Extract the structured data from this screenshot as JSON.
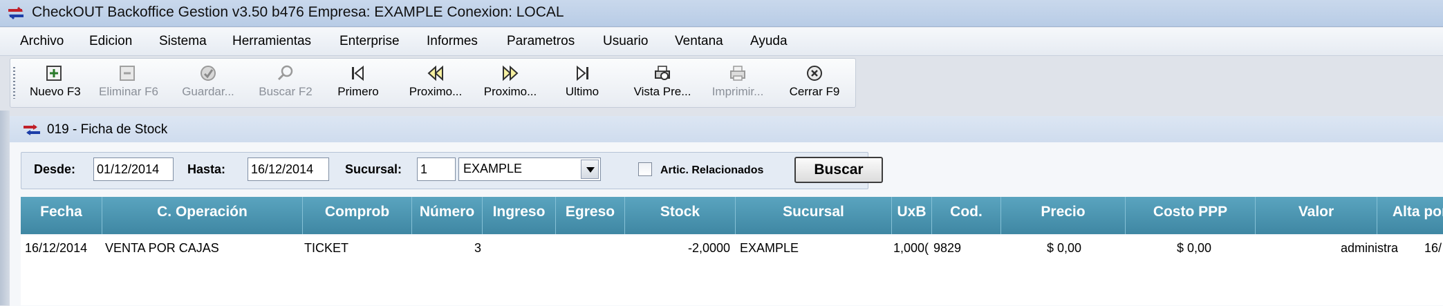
{
  "window": {
    "title": "CheckOUT Backoffice Gestion v3.50 b476 Empresa: EXAMPLE Conexion: LOCAL"
  },
  "menu": [
    {
      "label": "Archivo"
    },
    {
      "label": "Edicion"
    },
    {
      "label": "Sistema"
    },
    {
      "label": "Herramientas"
    },
    {
      "label": "Enterprise"
    },
    {
      "label": "Informes"
    },
    {
      "label": "Parametros"
    },
    {
      "label": "Usuario"
    },
    {
      "label": "Ventana"
    },
    {
      "label": "Ayuda"
    }
  ],
  "toolbar": [
    {
      "label": "Nuevo F3",
      "icon": "new-icon",
      "enabled": true
    },
    {
      "label": "Eliminar F6",
      "icon": "delete-icon",
      "enabled": false
    },
    {
      "label": "Guardar...",
      "icon": "save-icon",
      "enabled": false
    },
    {
      "label": "Buscar F2",
      "icon": "search-icon",
      "enabled": false
    },
    {
      "label": "Primero",
      "icon": "first-icon",
      "enabled": true
    },
    {
      "label": "Proximo...",
      "icon": "previous-icon",
      "enabled": true
    },
    {
      "label": "Proximo...",
      "icon": "next-icon",
      "enabled": true
    },
    {
      "label": "Ultimo",
      "icon": "last-icon",
      "enabled": true
    },
    {
      "label": "Vista Pre...",
      "icon": "print-preview-icon",
      "enabled": true
    },
    {
      "label": "Imprimir...",
      "icon": "print-icon",
      "enabled": false
    },
    {
      "label": "Cerrar F9",
      "icon": "close-icon",
      "enabled": true
    }
  ],
  "form": {
    "title": "019 - Ficha de Stock",
    "filters": {
      "desde_label": "Desde:",
      "desde_value": "01/12/2014",
      "hasta_label": "Hasta:",
      "hasta_value": "16/12/2014",
      "sucursal_label": "Sucursal:",
      "sucursal_code": "1",
      "sucursal_name": "EXAMPLE",
      "artic_label": "Artic. Relacionados",
      "artic_checked": false,
      "buscar_label": "Buscar"
    }
  },
  "grid": {
    "columns": [
      "Fecha",
      "C. Operación",
      "Comprob",
      "Número",
      "Ingreso",
      "Egreso",
      "Stock",
      "Sucursal",
      "UxB",
      "Cod.",
      "Precio",
      "Costo PPP",
      "Valor",
      "Alta por"
    ],
    "rows": [
      {
        "fecha": "16/12/2014",
        "operacion": "VENTA POR CAJAS",
        "comprob": "TICKET",
        "numero": "3",
        "ingreso": "",
        "egreso": "",
        "stock": "-2,0000",
        "sucursal": "EXAMPLE",
        "uxb": "1,000(",
        "cod": "9829",
        "precio": "$ 0,00",
        "costo": "$ 0,00",
        "valor": "",
        "alta": "administra",
        "extra": "16/"
      }
    ]
  },
  "colors": {
    "header_bg": "#4a94b0",
    "titlebar_bg": "#c2d3ea",
    "accent_red": "#c0202a",
    "accent_blue": "#1d3ea8"
  }
}
